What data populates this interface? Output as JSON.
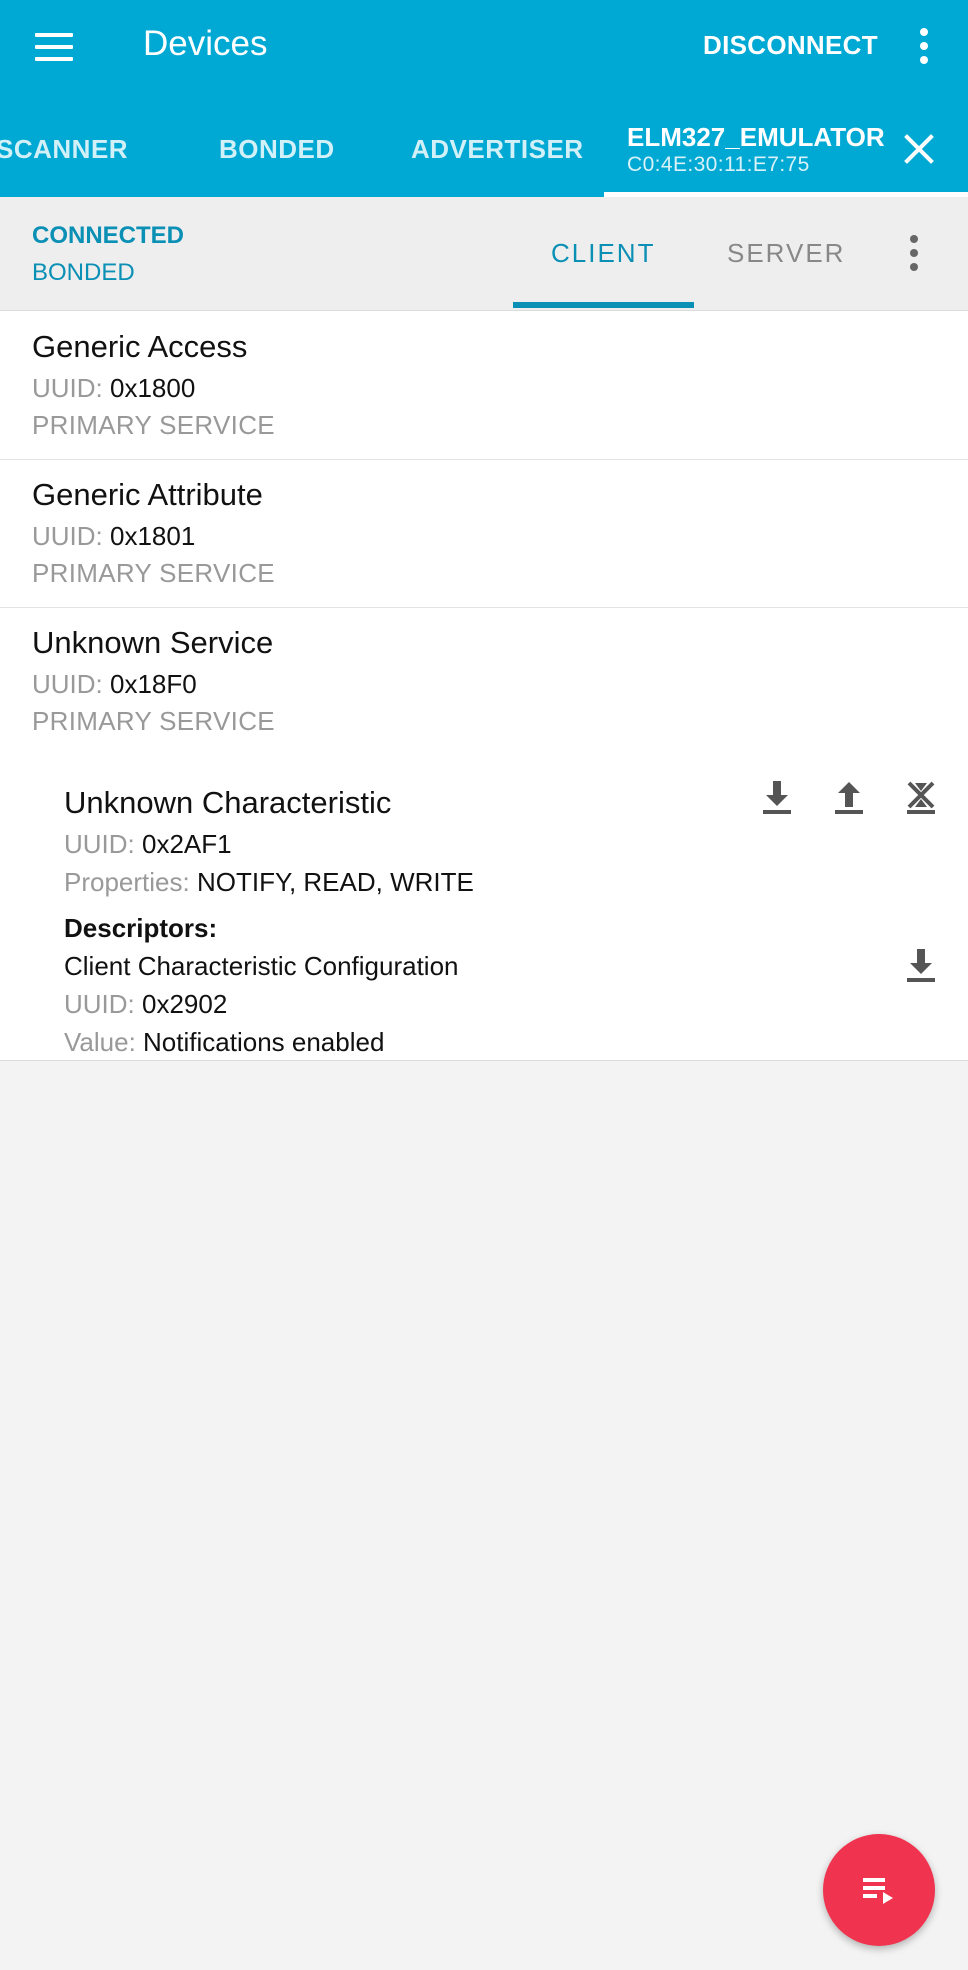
{
  "appbar": {
    "title": "Devices",
    "disconnect_label": "DISCONNECT",
    "background": "#00a9d4",
    "tabs": [
      {
        "label": "SCANNER"
      },
      {
        "label": "BONDED"
      },
      {
        "label": "ADVERTISER"
      }
    ],
    "device_tab": {
      "name": "ELM327_EMULATOR",
      "mac": "C0:4E:30:11:E7:75"
    }
  },
  "connection": {
    "status": "CONNECTED",
    "bond_state": "BONDED",
    "tabs": [
      {
        "label": "CLIENT",
        "selected": true
      },
      {
        "label": "SERVER",
        "selected": false
      }
    ],
    "accent": "#0a8fb5"
  },
  "services": [
    {
      "name": "Generic Access",
      "uuid_label": "UUID:",
      "uuid": "0x1800",
      "type": "PRIMARY SERVICE"
    },
    {
      "name": "Generic Attribute",
      "uuid_label": "UUID:",
      "uuid": "0x1801",
      "type": "PRIMARY SERVICE"
    },
    {
      "name": "Unknown Service",
      "uuid_label": "UUID:",
      "uuid": "0x18F0",
      "type": "PRIMARY SERVICE"
    }
  ],
  "characteristic": {
    "name": "Unknown Characteristic",
    "uuid_label": "UUID:",
    "uuid": "0x2AF1",
    "properties_label": "Properties:",
    "properties": "NOTIFY, READ, WRITE",
    "descriptors_label": "Descriptors:",
    "actions": [
      "download-icon",
      "upload-icon",
      "notifications-off-icon"
    ],
    "descriptor": {
      "name": "Client Characteristic Configuration",
      "uuid_label": "UUID:",
      "uuid": "0x2902",
      "value_label": "Value:",
      "value": "Notifications enabled",
      "action": "download-icon"
    }
  },
  "fab": {
    "icon": "log-list-icon",
    "color": "#f0334f"
  }
}
